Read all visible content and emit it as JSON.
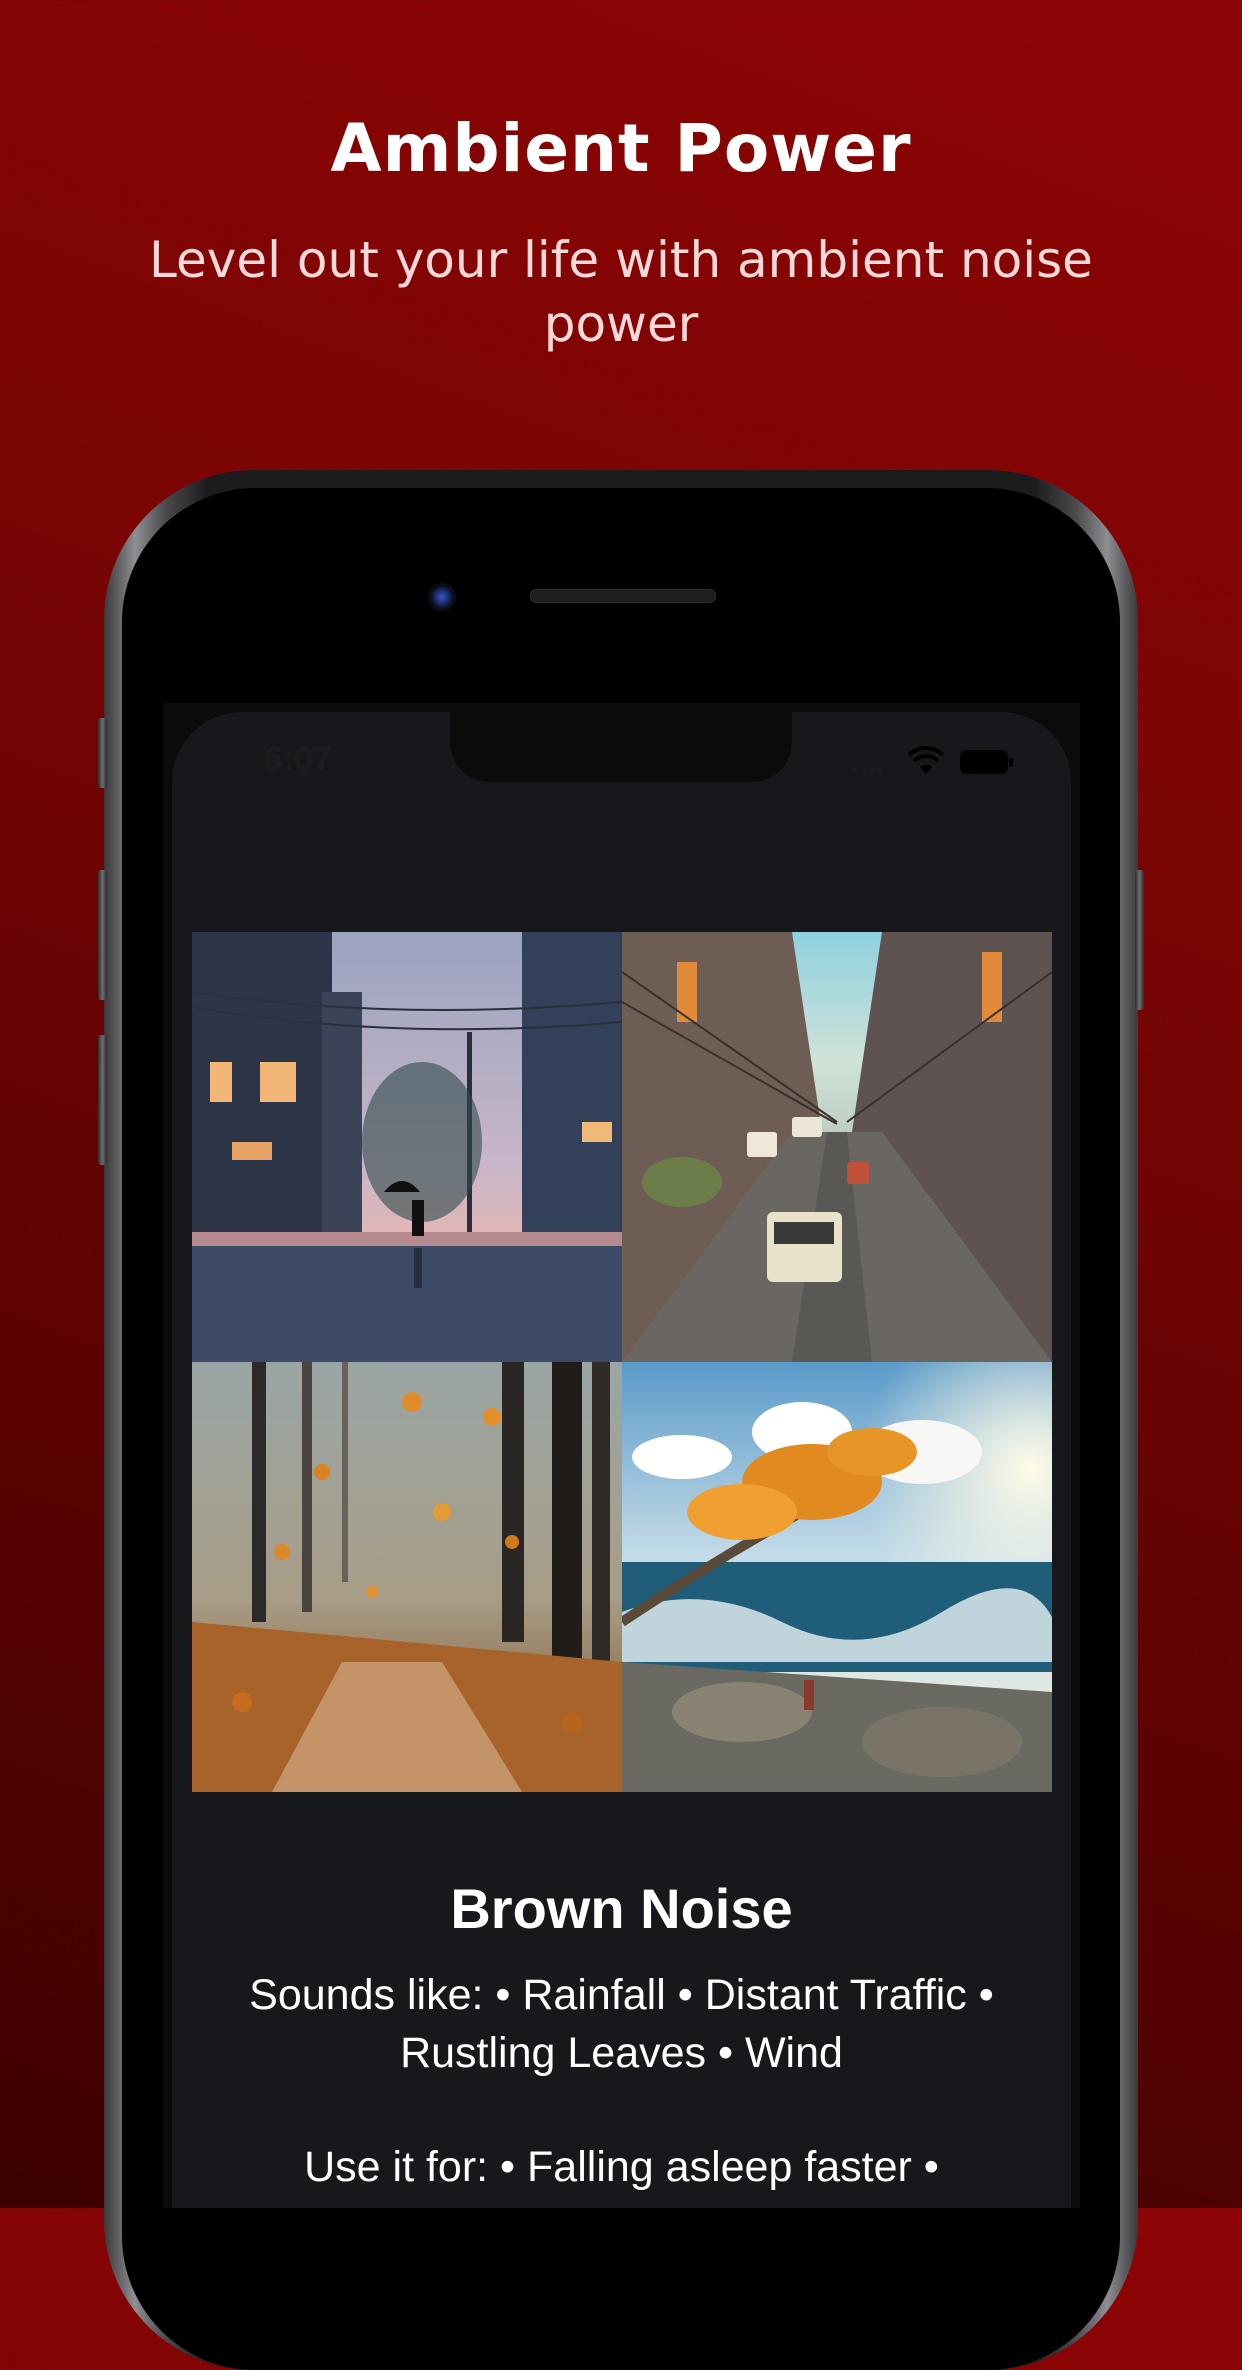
{
  "hero": {
    "title": "Ambient Power",
    "subtitle": "Level out your life with ambient noise power"
  },
  "status_bar": {
    "time": "6:07"
  },
  "icons": {
    "signal": "cellular-signal-icon",
    "wifi": "wifi-icon",
    "battery": "battery-icon"
  },
  "scenes": [
    {
      "name": "rainy-street"
    },
    {
      "name": "city-traffic"
    },
    {
      "name": "autumn-forest"
    },
    {
      "name": "windy-coast"
    }
  ],
  "sound": {
    "title": "Brown Noise",
    "sounds_like": "Sounds like: • Rainfall • Distant Traffic • Rustling Leaves • Wind",
    "use_it_for": "Use it for: • Falling asleep faster •"
  },
  "colors": {
    "background": "#7a0505",
    "screen": "#17181b",
    "text": "#ffffff"
  }
}
